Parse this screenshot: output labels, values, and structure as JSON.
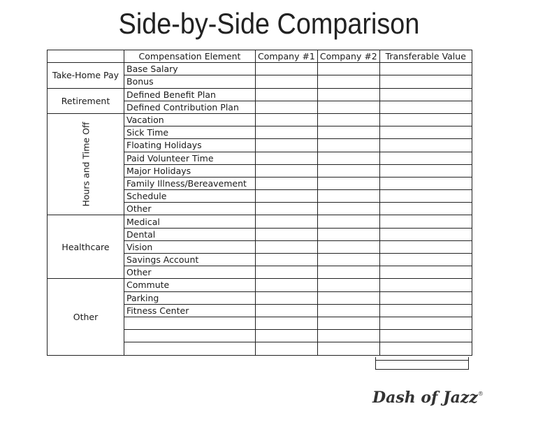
{
  "title": "Side-by-Side Comparison",
  "header": {
    "blank": "",
    "element": "Compensation Element",
    "company1": "Company #1",
    "company2": "Company #2",
    "transferable": "Transferable Value"
  },
  "groups": [
    {
      "category": "Take-Home Pay",
      "items": [
        "Base Salary",
        "Bonus"
      ]
    },
    {
      "category": "Retirement",
      "items": [
        "Defined Benefit Plan",
        "Defined Contribution Plan"
      ]
    },
    {
      "category": "Hours and Time Off",
      "vertical": true,
      "items": [
        "Vacation",
        "Sick Time",
        "Floating Holidays",
        "Paid Volunteer Time",
        "Major Holidays",
        "Family Illness/Bereavement",
        "Schedule",
        "Other"
      ]
    },
    {
      "category": "Healthcare",
      "items": [
        "Medical",
        "Dental",
        "Vision",
        "Savings Account",
        "Other"
      ]
    },
    {
      "category": "Other",
      "items": [
        "Commute",
        "Parking",
        "Fitness Center",
        "",
        "",
        ""
      ]
    }
  ],
  "logo": {
    "text": "Dash of Jazz",
    "mark": "®"
  }
}
